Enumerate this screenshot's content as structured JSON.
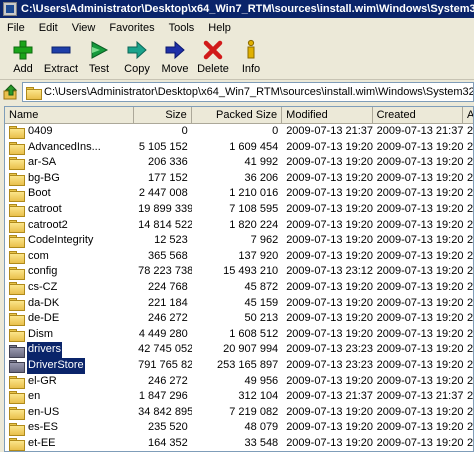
{
  "window": {
    "title": "C:\\Users\\Administrator\\Desktop\\x64_Win7_RTM\\sources\\install.wim\\Windows\\System32\\"
  },
  "menu": [
    "File",
    "Edit",
    "View",
    "Favorites",
    "Tools",
    "Help"
  ],
  "toolbar": [
    {
      "label": "Add",
      "icon": "add-icon",
      "color": "#1aa41a"
    },
    {
      "label": "Extract",
      "icon": "extract-icon",
      "color": "#1e3ea8"
    },
    {
      "label": "Test",
      "icon": "test-icon",
      "color": "#159a3c"
    },
    {
      "label": "Copy",
      "icon": "copy-icon",
      "color": "#1aa38b"
    },
    {
      "label": "Move",
      "icon": "move-icon",
      "color": "#1e2fa8"
    },
    {
      "label": "Delete",
      "icon": "delete-icon",
      "color": "#d11a1a"
    },
    {
      "label": "Info",
      "icon": "info-icon",
      "color": "#e0b000"
    }
  ],
  "address": {
    "path": "C:\\Users\\Administrator\\Desktop\\x64_Win7_RTM\\sources\\install.wim\\Windows\\System32\\"
  },
  "columns": {
    "name": "Name",
    "size": "Size",
    "packed": "Packed Size",
    "modified": "Modified",
    "created": "Created",
    "accessed": "A"
  },
  "rows": [
    {
      "name": "0409",
      "size": "0",
      "packed": "0",
      "modified": "2009-07-13 21:37",
      "created": "2009-07-13 21:37",
      "accessed": "2",
      "selected": false
    },
    {
      "name": "AdvancedIns...",
      "size": "5 105 152",
      "packed": "1 609 454",
      "modified": "2009-07-13 19:20",
      "created": "2009-07-13 19:20",
      "accessed": "2",
      "selected": false
    },
    {
      "name": "ar-SA",
      "size": "206 336",
      "packed": "41 992",
      "modified": "2009-07-13 19:20",
      "created": "2009-07-13 19:20",
      "accessed": "2",
      "selected": false
    },
    {
      "name": "bg-BG",
      "size": "177 152",
      "packed": "36 206",
      "modified": "2009-07-13 19:20",
      "created": "2009-07-13 19:20",
      "accessed": "2",
      "selected": false
    },
    {
      "name": "Boot",
      "size": "2 447 008",
      "packed": "1 210 016",
      "modified": "2009-07-13 19:20",
      "created": "2009-07-13 19:20",
      "accessed": "2",
      "selected": false
    },
    {
      "name": "catroot",
      "size": "19 899 339",
      "packed": "7 108 595",
      "modified": "2009-07-13 19:20",
      "created": "2009-07-13 19:20",
      "accessed": "2",
      "selected": false
    },
    {
      "name": "catroot2",
      "size": "14 814 522",
      "packed": "1 820 224",
      "modified": "2009-07-13 19:20",
      "created": "2009-07-13 19:20",
      "accessed": "2",
      "selected": false
    },
    {
      "name": "CodeIntegrity",
      "size": "12 523",
      "packed": "7 962",
      "modified": "2009-07-13 19:20",
      "created": "2009-07-13 19:20",
      "accessed": "2",
      "selected": false
    },
    {
      "name": "com",
      "size": "365 568",
      "packed": "137 920",
      "modified": "2009-07-13 19:20",
      "created": "2009-07-13 19:20",
      "accessed": "2",
      "selected": false
    },
    {
      "name": "config",
      "size": "78 223 738",
      "packed": "15 493 210",
      "modified": "2009-07-13 23:12",
      "created": "2009-07-13 19:20",
      "accessed": "2",
      "selected": false
    },
    {
      "name": "cs-CZ",
      "size": "224 768",
      "packed": "45 872",
      "modified": "2009-07-13 19:20",
      "created": "2009-07-13 19:20",
      "accessed": "2",
      "selected": false
    },
    {
      "name": "da-DK",
      "size": "221 184",
      "packed": "45 159",
      "modified": "2009-07-13 19:20",
      "created": "2009-07-13 19:20",
      "accessed": "2",
      "selected": false
    },
    {
      "name": "de-DE",
      "size": "246 272",
      "packed": "50 213",
      "modified": "2009-07-13 19:20",
      "created": "2009-07-13 19:20",
      "accessed": "2",
      "selected": false
    },
    {
      "name": "Dism",
      "size": "4 449 280",
      "packed": "1 608 512",
      "modified": "2009-07-13 19:20",
      "created": "2009-07-13 19:20",
      "accessed": "2",
      "selected": false
    },
    {
      "name": "drivers",
      "size": "42 745 052",
      "packed": "20 907 994",
      "modified": "2009-07-13 23:23",
      "created": "2009-07-13 19:20",
      "accessed": "2",
      "selected": true
    },
    {
      "name": "DriverStore",
      "size": "791 765 826",
      "packed": "253 165 897",
      "modified": "2009-07-13 23:23",
      "created": "2009-07-13 19:20",
      "accessed": "2",
      "selected": true
    },
    {
      "name": "el-GR",
      "size": "246 272",
      "packed": "49 956",
      "modified": "2009-07-13 19:20",
      "created": "2009-07-13 19:20",
      "accessed": "2",
      "selected": false
    },
    {
      "name": "en",
      "size": "1 847 296",
      "packed": "312 104",
      "modified": "2009-07-13 21:37",
      "created": "2009-07-13 21:37",
      "accessed": "2",
      "selected": false
    },
    {
      "name": "en-US",
      "size": "34 842 895",
      "packed": "7 219 082",
      "modified": "2009-07-13 19:20",
      "created": "2009-07-13 19:20",
      "accessed": "2",
      "selected": false
    },
    {
      "name": "es-ES",
      "size": "235 520",
      "packed": "48 079",
      "modified": "2009-07-13 19:20",
      "created": "2009-07-13 19:20",
      "accessed": "2",
      "selected": false
    },
    {
      "name": "et-EE",
      "size": "164 352",
      "packed": "33 548",
      "modified": "2009-07-13 19:20",
      "created": "2009-07-13 19:20",
      "accessed": "2",
      "selected": false
    }
  ]
}
